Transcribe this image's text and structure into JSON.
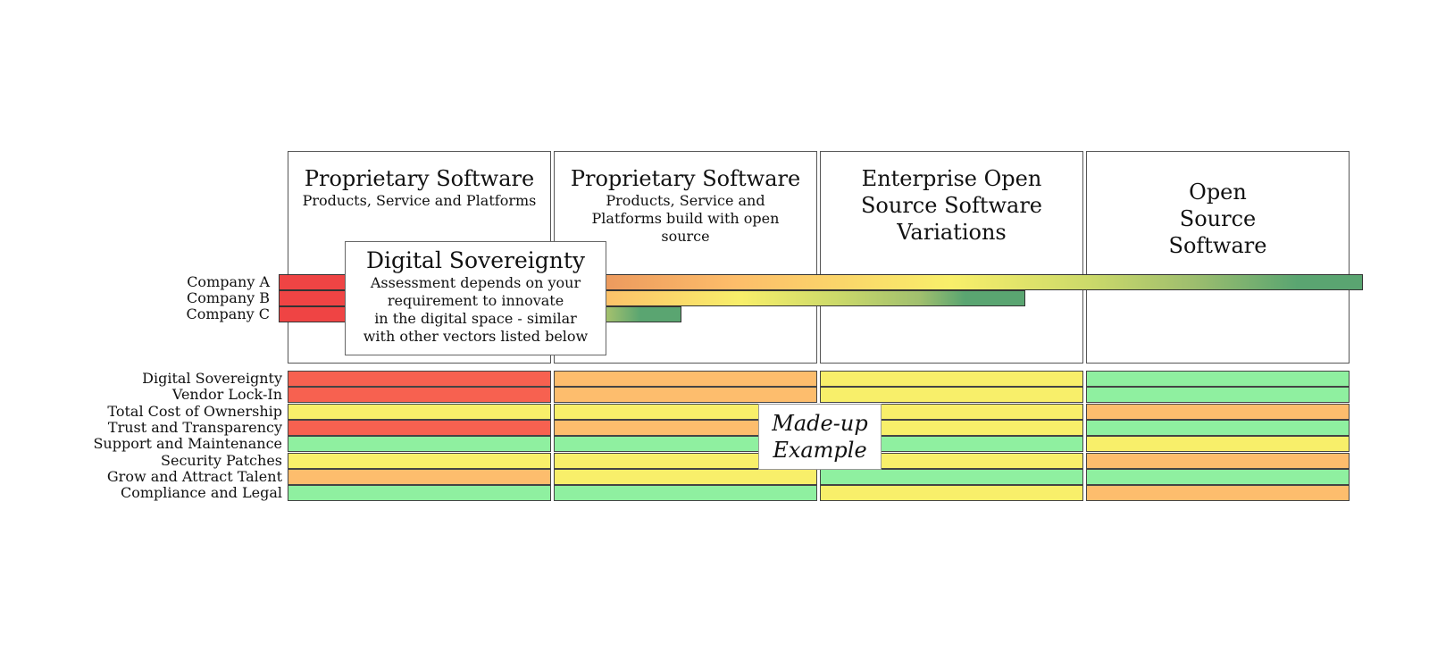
{
  "columns": [
    {
      "title": "Proprietary Software",
      "subtitle": "Products, Service and Platforms"
    },
    {
      "title": "Proprietary Software",
      "subtitle": "Products, Service and Platforms build with open source"
    },
    {
      "title": "Enterprise Open Source Software Variations",
      "subtitle": ""
    },
    {
      "title": "Open Source Software",
      "subtitle": ""
    }
  ],
  "companies": [
    {
      "name": "Company A",
      "gradient": "red to green"
    },
    {
      "name": "Company B",
      "gradient": "red to green"
    },
    {
      "name": "Company C",
      "gradient": "red to green"
    }
  ],
  "popup": {
    "title": "Digital Sovereignty",
    "lines": [
      "Assessment depends on your",
      "requirement to innovate",
      "in the digital space - similar",
      "with other vectors listed below"
    ]
  },
  "colors": {
    "red": "#f76150",
    "orange": "#fdbd6d",
    "yellow": "#f8ef6a",
    "green": "#8ff0a0"
  },
  "criteria": [
    {
      "label": "Digital Sovereignty",
      "ratings": [
        "red",
        "orange",
        "yellow",
        "green"
      ]
    },
    {
      "label": "Vendor Lock-In",
      "ratings": [
        "red",
        "orange",
        "yellow",
        "green"
      ]
    },
    {
      "label": "Total Cost of Ownership",
      "ratings": [
        "yellow",
        "yellow",
        "yellow",
        "orange"
      ]
    },
    {
      "label": "Trust and Transparency",
      "ratings": [
        "red",
        "orange",
        "yellow",
        "green"
      ]
    },
    {
      "label": "Support and Maintenance",
      "ratings": [
        "green",
        "green",
        "green",
        "yellow"
      ]
    },
    {
      "label": "Security Patches",
      "ratings": [
        "yellow",
        "yellow",
        "yellow",
        "orange"
      ]
    },
    {
      "label": "Grow and Attract Talent",
      "ratings": [
        "orange",
        "yellow",
        "green",
        "green"
      ]
    },
    {
      "label": "Compliance and Legal",
      "ratings": [
        "green",
        "green",
        "yellow",
        "orange"
      ]
    }
  ],
  "watermark": {
    "line1": "Made-up",
    "line2": "Example"
  }
}
